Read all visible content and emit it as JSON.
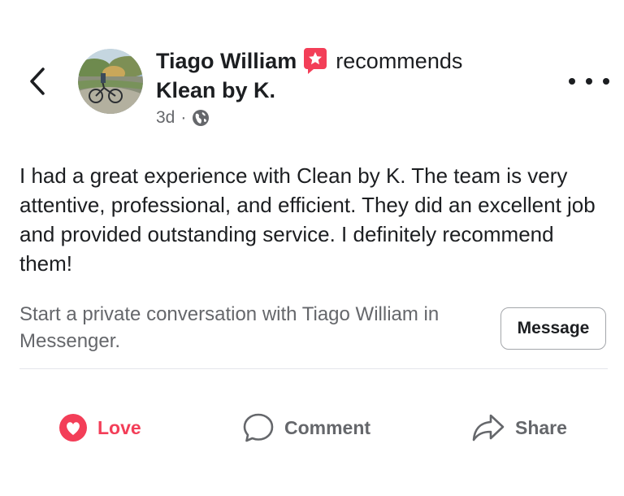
{
  "post": {
    "author": "Tiago William",
    "verb": "recommends",
    "page": "Klean by K.",
    "time": "3d",
    "separator": "·",
    "body": "I had a great experience with Clean by K. The team is very attentive, professional, and efficient. They did an excellent job and provided outstanding service. I definitely recommend them!"
  },
  "messenger": {
    "prompt": "Start a private conversation with Tiago William in Messenger.",
    "button_label": "Message"
  },
  "actions": {
    "love": "Love",
    "comment": "Comment",
    "share": "Share"
  },
  "icons": {
    "back": "chevron-left-icon",
    "recommend_badge": "star-badge-icon",
    "audience": "globe-icon",
    "more": "more-horizontal-icon",
    "love": "heart-icon",
    "comment": "comment-bubble-icon",
    "share": "share-arrow-icon"
  },
  "colors": {
    "love": "#f33e58",
    "badge": "#f33e58",
    "secondary_text": "#65676b",
    "primary_text": "#1c1e21"
  }
}
